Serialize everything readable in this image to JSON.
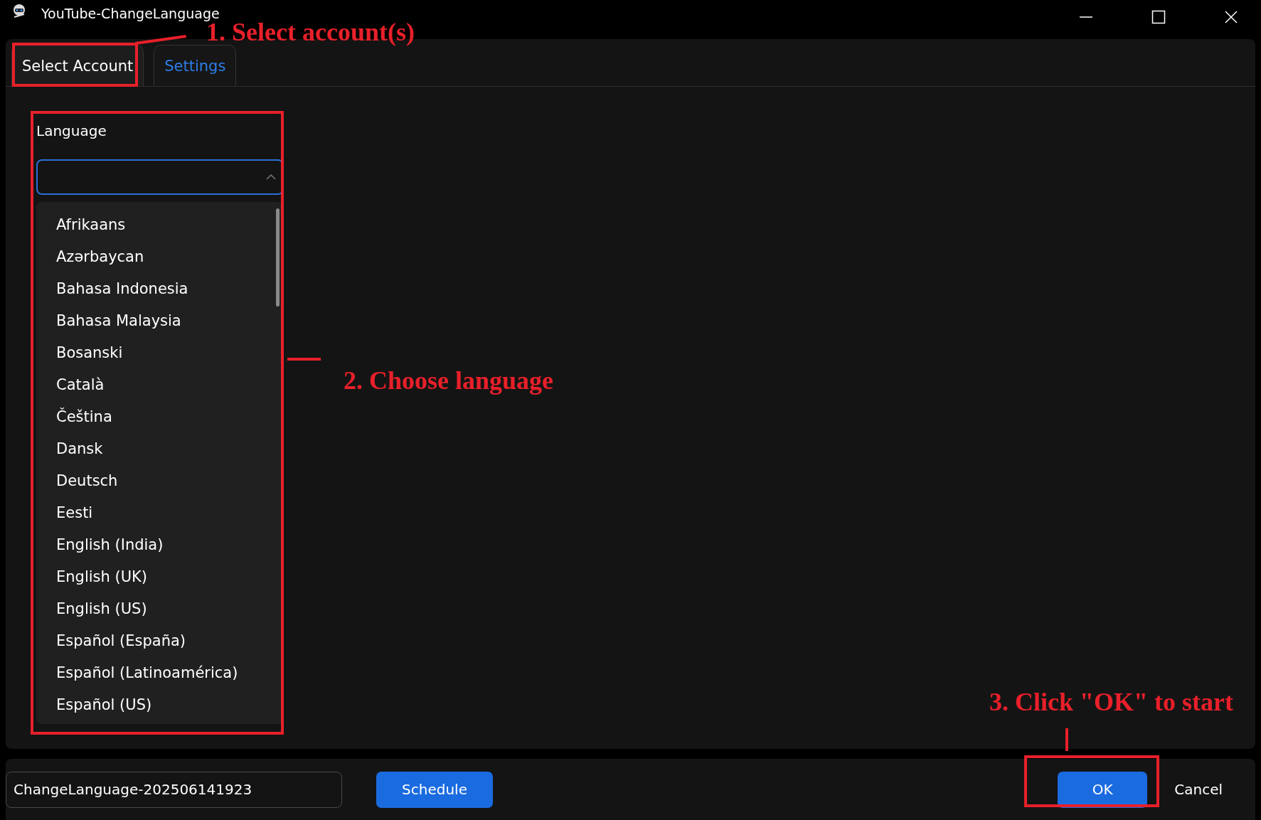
{
  "window": {
    "title": "YouTube-ChangeLanguage"
  },
  "tabs": [
    {
      "label": "Select Account",
      "selected": true
    },
    {
      "label": "Settings",
      "selected": false
    }
  ],
  "language": {
    "label": "Language",
    "expanded": true,
    "options": [
      "Afrikaans",
      "Azərbaycan",
      "Bahasa Indonesia",
      "Bahasa Malaysia",
      "Bosanski",
      "Català",
      "Čeština",
      "Dansk",
      "Deutsch",
      "Eesti",
      "English (India)",
      "English (UK)",
      "English (US)",
      "Español (España)",
      "Español (Latinoamérica)",
      "Español (US)"
    ]
  },
  "footer": {
    "task_name": "ChangeLanguage-202506141923",
    "schedule_button": "Schedule",
    "ok_button": "OK",
    "cancel_button": "Cancel"
  },
  "annotations": [
    "1. Select account(s)",
    "2. Choose language",
    "3. Click \"OK\" to start"
  ]
}
